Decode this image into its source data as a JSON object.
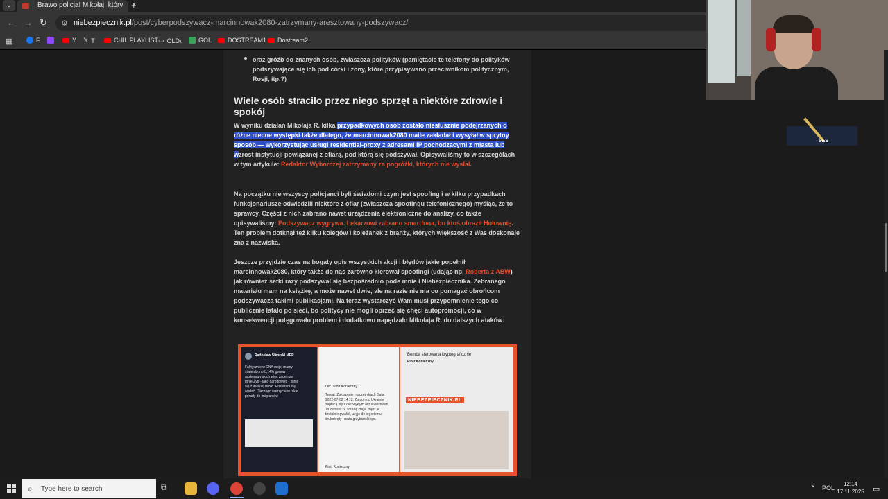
{
  "browser": {
    "tab_title": "Brawo policja! Mikołaj, który p",
    "tab_close": "×",
    "new_tab": "+",
    "url_host": "niebezpiecznik.pl",
    "url_path": "/post/cyberpodszywacz-marcinnowak2080-zatrzymany-aresztowany-podszywacz/",
    "bookmarks": [
      {
        "label": "F",
        "color": "#1877f2"
      },
      {
        "label": "",
        "color": "#9146ff"
      },
      {
        "label": "Y",
        "color": "#ff0000"
      },
      {
        "label": "T",
        "color": "#ffffff"
      },
      {
        "label": "CHIL PLAYLIST",
        "color": "#ff0000"
      },
      {
        "label": "OLD\\",
        "color": "#cccccc"
      },
      {
        "label": "GOL",
        "color": "#3aa35b"
      },
      {
        "label": "DOSTREAM1",
        "color": "#ff0000"
      },
      {
        "label": "Dostream2",
        "color": "#ff0000"
      }
    ]
  },
  "article": {
    "bullet": "oraz gróźb do znanych osób, zwłaszcza polityków (pamiętacie te telefony do polityków podszywające się ich pod córki i żony, które przypisywano przeciwnikom politycznym, Rosji, itp.?)",
    "heading": "Wiele osób straciło przez niego sprzęt a niektóre zdrowie i spokój",
    "p1_a": "W wyniku działań Mikołaja R. kilka ",
    "p1_hl": "przypadkowych osób zostało niesłusznie podejrzanych o różne niecne występki także dlatego, że marcinnowak2080 maile zakładał i wysyłał w sprytny sposób — wykorzystując usługi residential-proxy z adresami IP pochodzącymi z miasta lub w",
    "p1_b": "zrost instytucji powiązanej z ofiarą, pod którą się podszywał.",
    "p1_c": " Opisywaliśmy to w szczegółach w tym artykule: ",
    "p1_link": "Redaktor Wyborczej zatrzymany za pogróżki, których nie wysłał",
    "p1_end": ".",
    "p2_a": "Na początku nie wszyscy policjanci byli świadomi czym jest spoofing i w kilku przypadkach funkcjonariusze odwiedzili niektóre z ofiar (zwłaszcza spoofingu telefonicznego) myśląc, że to sprawcy. Części z nich zabrano nawet urządzenia elektroniczne do analizy, co także opisywaliśmy: ",
    "p2_link": "Podszywacz wygrywa. Lekarzowi zabrano smartfona, bo ktoś obraził Hołownię",
    "p2_b": ". Ten problem dotknął też kilku kolegów i koleżanek z branży, których większość z Was doskonale zna z nazwiska.",
    "p3_a": "Jeszcze przyjdzie czas na bogaty opis wszystkich akcji i błędów jakie popełnił marcinnowak2080, który także do nas zarówno kierował spoofingi (udając np. ",
    "p3_link": "Roberta z ABW",
    "p3_b": ") jak również setki razy podszywał się bezpośrednio pode mnie i Niebezpiecznika. Zebranego materiału mam na książkę, a może nawet dwie, ale na razie nie ma co pomagać obrońcom podszywacza takimi publikacjami. Na teraz wystarczyć Wam musi przypomnienie tego co publicznie latało po sieci, bo politycy nie mogli oprzeć się chęci autopromocji, co w konsekwencji potęgowało problem i dodatkowo napędzało Mikołaja R. do dalszych ataków:"
  },
  "image": {
    "p1_name": "Radosław Sikorski MEP",
    "p1_text": "Faktycznie w DNA mojej mamy stwierdzono 0,14% genów aszkenazyjskich więc żaden ze mnie Żyd - jako narodowiec - pilnie się z wielkiej troski. Postaram się wydać. Dlaczego wierzycie w takie porady do imigrantów",
    "p2_from": "Od: \"Piotr Konieczny\"",
    "p2_text": "Temat: Zgłoszenie maczetnikach Data: 2022-07-02 14:12. Za pomoc Ukrainie zapłacą się z niezwykłym okrucieństwem. To zemsta za zdradę kraju. Bądź je brutalnie gwałcił, użyje do tego tomu, śrubokręty i noża grzybiarskiego.",
    "p2_sig": "Piotr Konieczny",
    "p3_title": "Bomba sterowana kryptograficznie",
    "p3_sender": "Piotr Konieczny",
    "watermark": "NIEBEZPIECZNIK.PL"
  },
  "overlay": {
    "floater_text": "SES"
  },
  "taskbar": {
    "search_placeholder": "Type here to search",
    "lang": "POL",
    "time": "12:14",
    "date": "17.11.2025"
  }
}
